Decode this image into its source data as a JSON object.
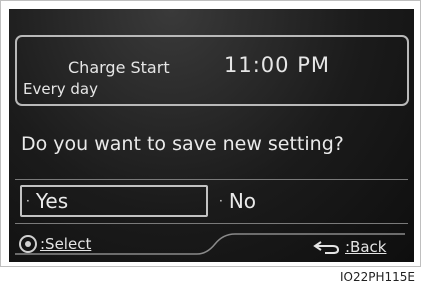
{
  "timer": {
    "label": "Charge Start",
    "time": "11:00 PM",
    "repeat": "Every day"
  },
  "dialog": {
    "question": "Do you want to save new setting?",
    "yes_label": "Yes",
    "no_label": "No",
    "bullet": "·"
  },
  "controls": {
    "select_label": ":Select",
    "back_label": ":Back"
  },
  "figure_id": "IO22PH115E"
}
